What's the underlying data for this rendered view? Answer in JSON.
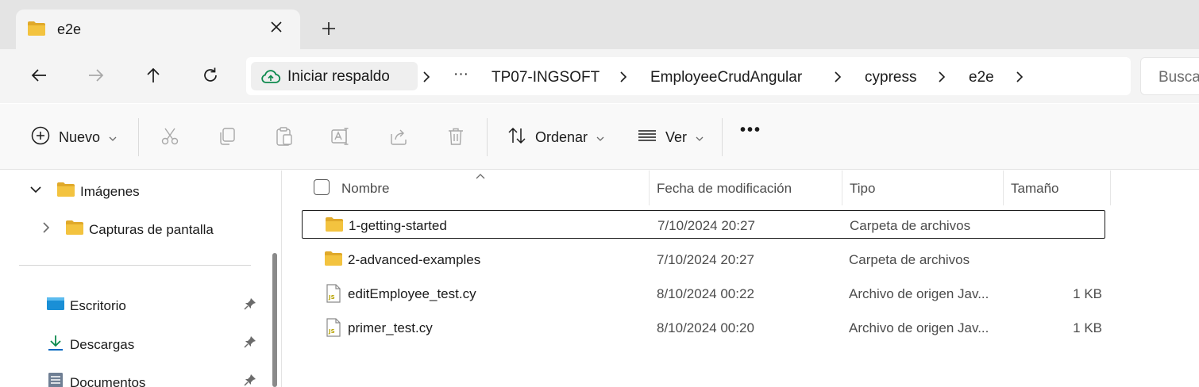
{
  "tab": {
    "title": "e2e",
    "close_label": "close",
    "new_tab_label": "new tab"
  },
  "address": {
    "backup_label": "Iniciar respaldo",
    "overflow": "···",
    "crumbs": [
      "TP07-INGSOFT",
      "EmployeeCrudAngular",
      "cypress",
      "e2e"
    ],
    "search_placeholder": "Busca"
  },
  "commands": {
    "new_label": "Nuevo",
    "sort_label": "Ordenar",
    "view_label": "Ver",
    "more_label": "•••"
  },
  "sidebar": {
    "items": [
      {
        "label": "Imágenes",
        "icon": "folder-icon",
        "expanded": true
      },
      {
        "label": "Capturas de pantalla",
        "icon": "folder-icon",
        "expanded": false
      },
      {
        "label": "Escritorio",
        "icon": "desktop-icon",
        "pinned": true
      },
      {
        "label": "Descargas",
        "icon": "download-icon",
        "pinned": true
      },
      {
        "label": "Documentos",
        "icon": "documents-icon",
        "pinned": true
      }
    ]
  },
  "columns": {
    "name": "Nombre",
    "modified": "Fecha de modificación",
    "type": "Tipo",
    "size": "Tamaño"
  },
  "files": [
    {
      "name": "1-getting-started",
      "modified": "7/10/2024 20:27",
      "type": "Carpeta de archivos",
      "size": "",
      "icon": "folder-icon",
      "selected": true
    },
    {
      "name": "2-advanced-examples",
      "modified": "7/10/2024 20:27",
      "type": "Carpeta de archivos",
      "size": "",
      "icon": "folder-icon",
      "selected": false
    },
    {
      "name": "editEmployee_test.cy",
      "modified": "8/10/2024 00:22",
      "type": "Archivo de origen Jav...",
      "size": "1 KB",
      "icon": "js-file-icon",
      "selected": false
    },
    {
      "name": "primer_test.cy",
      "modified": "8/10/2024 00:20",
      "type": "Archivo de origen Jav...",
      "size": "1 KB",
      "icon": "js-file-icon",
      "selected": false
    }
  ],
  "colors": {
    "folder": "#f3c33f",
    "folder_dark": "#e0a92a",
    "accent_green": "#0e8a4e",
    "accent_blue": "#0067c0"
  }
}
